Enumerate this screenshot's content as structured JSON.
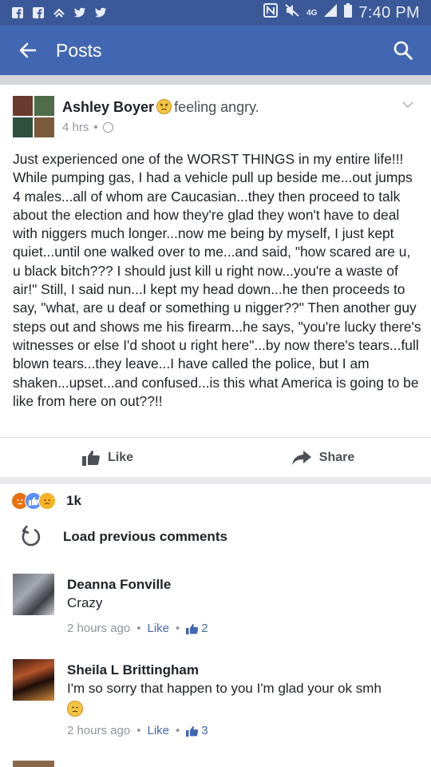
{
  "status_bar": {
    "time": "7:40 PM",
    "network": "4G",
    "left_icons": [
      "facebook-icon",
      "facebook-icon",
      "chevron-icon",
      "twitter-icon",
      "twitter-icon"
    ],
    "right_icons": [
      "nfc-icon",
      "mute-icon",
      "signal-icon",
      "battery-icon"
    ]
  },
  "app_bar": {
    "title": "Posts",
    "color": "#4267b2"
  },
  "post": {
    "author": "Ashley Boyer",
    "feeling": "feeling angry.",
    "time": "4 hrs",
    "body": "Just experienced one of the WORST THINGS in my entire life!!! While pumping gas, I had a vehicle pull up beside me...out jumps 4 males...all of whom are Caucasian...they then proceed to talk about the election and how they're glad they won't have to deal with niggers much longer...now me being by myself, I just kept quiet...until one walked over to me...and said, \"how scared are u, u black bitch??? I should just kill u right now...you're a waste of air!\" Still, I said nun...I kept my head down...he then proceeds to say, \"what, are u deaf or something u nigger??\" Then another guy steps out and shows me his firearm...he says, \"you're lucky there's witnesses or else I'd shoot u right here\"...by now there's tears...full blown tears...they leave...I have called the police, but I am shaken...upset...and confused...is this what America is going to be like from here on out??!!",
    "like_label": "Like",
    "share_label": "Share",
    "reaction_count": "1k",
    "reactions": [
      "angry",
      "like",
      "sad"
    ]
  },
  "load_previous": "Load previous comments",
  "comments": [
    {
      "name": "Deanna Fonville",
      "text": "Crazy",
      "time": "2 hours ago",
      "like_label": "Like",
      "likes": "2"
    },
    {
      "name": "Sheila L Brittingham",
      "text": "I'm so sorry that happen to you I'm glad your ok smh",
      "time": "2 hours ago",
      "like_label": "Like",
      "likes": "3"
    }
  ]
}
